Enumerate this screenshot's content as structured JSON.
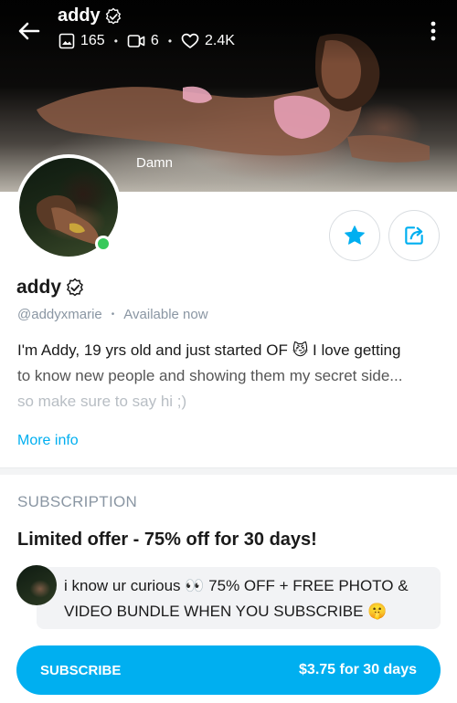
{
  "header": {
    "title": "addy",
    "stats": {
      "photos": "165",
      "videos": "6",
      "likes": "2.4K"
    },
    "cover_caption": "Damn"
  },
  "profile": {
    "display_name": "addy",
    "handle": "@addyxmarie",
    "status": "Available now",
    "bio": {
      "line1": "I'm Addy, 19 yrs old and just started OF 😼 I love getting",
      "line2": "to know new people and showing them my secret side...",
      "line3": "so make sure to say hi ;)"
    },
    "more_info": "More info"
  },
  "subscription": {
    "heading": "SUBSCRIPTION",
    "offer": "Limited offer - 75% off for 30 days!",
    "message": {
      "line1": "i know ur curious 👀 75% OFF + FREE PHOTO &",
      "line2": "VIDEO BUNDLE WHEN YOU SUBSCRIBE 🤫"
    },
    "button_label": "SUBSCRIBE",
    "price": "$3.75 for 30 days"
  },
  "colors": {
    "accent": "#00aff0",
    "online": "#37c95b",
    "muted": "#8a96a3"
  },
  "icons": [
    "back-arrow-icon",
    "verified-icon",
    "image-icon",
    "video-icon",
    "heart-icon",
    "more-vertical-icon",
    "star-icon",
    "share-icon"
  ]
}
